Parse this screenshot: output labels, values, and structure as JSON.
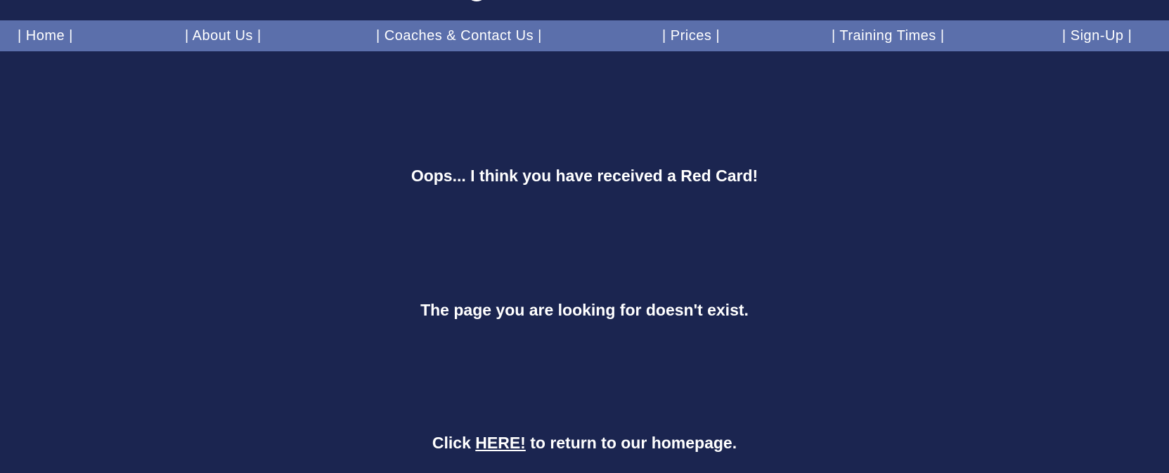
{
  "nav": {
    "items": [
      {
        "label": "| Home |"
      },
      {
        "label": "| About Us |"
      },
      {
        "label": "| Coaches & Contact Us |"
      },
      {
        "label": "| Prices |"
      },
      {
        "label": "| Training Times |"
      },
      {
        "label": "| Sign-Up |"
      }
    ]
  },
  "content": {
    "headline": "Oops... I think you have received a Red Card!",
    "subtext": "The page you are looking for doesn't exist.",
    "return_prefix": "Click ",
    "return_link": "HERE!",
    "return_suffix": " to return to our homepage."
  }
}
